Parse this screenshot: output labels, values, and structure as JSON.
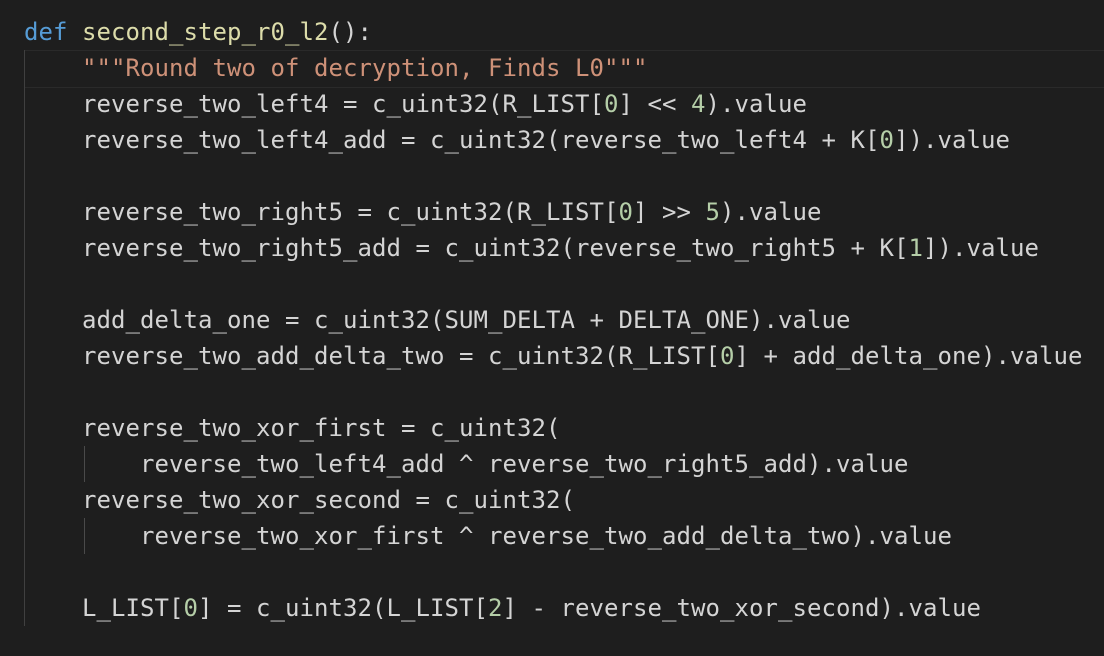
{
  "editor": {
    "theme": {
      "background": "#1e1e1e",
      "text": "#d4d4d4",
      "keyword": "#569cd6",
      "function": "#dcdcaa",
      "string": "#ce9178",
      "number": "#b5cea8",
      "indent_guide": "#404040"
    },
    "code": {
      "l1": {
        "kw": "def",
        "name": "second_step_r0_l2",
        "rest": "():"
      },
      "l2": {
        "docstring": "\"\"\"Round two of decryption, Finds L0\"\"\""
      },
      "l3": {
        "a": "reverse_two_left4 = c_uint32(R_LIST[",
        "n1": "0",
        "b": "] << ",
        "n2": "4",
        "c": ").value"
      },
      "l4": {
        "a": "reverse_two_left4_add = c_uint32(reverse_two_left4 + K[",
        "n1": "0",
        "b": "]).value"
      },
      "l6": {
        "a": "reverse_two_right5 = c_uint32(R_LIST[",
        "n1": "0",
        "b": "] >> ",
        "n2": "5",
        "c": ").value"
      },
      "l7": {
        "a": "reverse_two_right5_add = c_uint32(reverse_two_right5 + K[",
        "n1": "1",
        "b": "]).value"
      },
      "l9": {
        "a": "add_delta_one = c_uint32(SUM_DELTA + DELTA_ONE).value"
      },
      "l10": {
        "a": "reverse_two_add_delta_two = c_uint32(R_LIST[",
        "n1": "0",
        "b": "] + add_delta_one).value"
      },
      "l12": {
        "a": "reverse_two_xor_first = c_uint32("
      },
      "l13": {
        "a": "reverse_two_left4_add ^ reverse_two_right5_add).value"
      },
      "l14": {
        "a": "reverse_two_xor_second = c_uint32("
      },
      "l15": {
        "a": "reverse_two_xor_first ^ reverse_two_add_delta_two).value"
      },
      "l17": {
        "a": "L_LIST[",
        "n1": "0",
        "b": "] = c_uint32(L_LIST[",
        "n2": "2",
        "c": "] - reverse_two_xor_second).value"
      }
    }
  }
}
